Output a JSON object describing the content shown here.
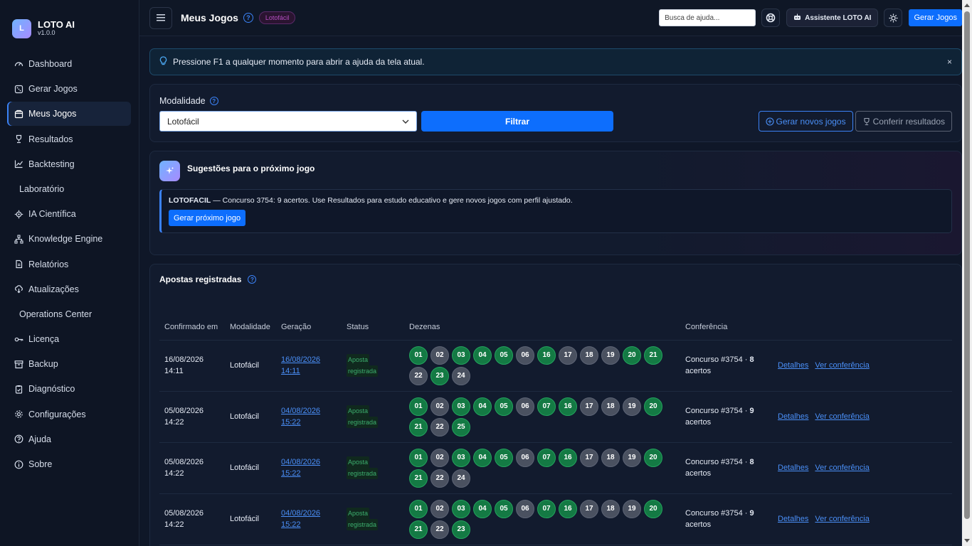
{
  "brand": {
    "name": "LOTO AI",
    "version": "v1.0.0",
    "logo_letter": "L"
  },
  "nav": [
    {
      "label": "Dashboard",
      "icon": "speedometer-icon"
    },
    {
      "label": "Gerar Jogos",
      "icon": "dice-icon"
    },
    {
      "label": "Meus Jogos",
      "icon": "box-icon",
      "active": true
    },
    {
      "label": "Resultados",
      "icon": "trophy-icon"
    },
    {
      "label": "Backtesting",
      "icon": "chart-line-icon"
    },
    {
      "label": "Laboratório",
      "icon": ""
    },
    {
      "label": "IA Científica",
      "icon": "cpu-icon"
    },
    {
      "label": "Knowledge Engine",
      "icon": "diagram-icon"
    },
    {
      "label": "Relatórios",
      "icon": "file-icon"
    },
    {
      "label": "Atualizações",
      "icon": "cloud-download-icon"
    },
    {
      "label": "Operations Center",
      "icon": ""
    },
    {
      "label": "Licença",
      "icon": "key-icon"
    },
    {
      "label": "Backup",
      "icon": "archive-icon"
    },
    {
      "label": "Diagnóstico",
      "icon": "clipboard-icon"
    },
    {
      "label": "Configurações",
      "icon": "gear-icon"
    },
    {
      "label": "Ajuda",
      "icon": "question-icon"
    },
    {
      "label": "Sobre",
      "icon": "info-icon"
    }
  ],
  "topbar": {
    "title": "Meus Jogos",
    "pill": "Lotofácil",
    "search_placeholder": "Busca de ajuda...",
    "assistant_label": "Assistente LOTO AI",
    "generate_label": "Gerar Jogos"
  },
  "alert": {
    "text": "Pressione F1 a qualquer momento para abrir a ajuda da tela atual.",
    "close": "×"
  },
  "filter": {
    "label": "Modalidade",
    "selected": "Lotofácil",
    "filter_button": "Filtrar",
    "new_games": "Gerar novos jogos",
    "check_results": "Conferir resultados"
  },
  "suggestion": {
    "title": "Sugestões para o próximo jogo",
    "game": "LOTOFACIL",
    "text": " — Concurso 3754: 9 acertos. Use Resultados para estudo educativo e gere novos jogos com perfil ajustado.",
    "button": "Gerar próximo jogo"
  },
  "bets": {
    "title": "Apostas registradas",
    "headers": [
      "Confirmado em",
      "Modalidade",
      "Geração",
      "Status",
      "Dezenas",
      "Conferência",
      ""
    ],
    "detail_label": "Detalhes",
    "conf_label": "Ver conferência",
    "rows": [
      {
        "confirmed_date": "16/08/2026",
        "confirmed_time": "14:11",
        "modality": "Lotofácil",
        "gen_date": "16/08/2026",
        "gen_time": "14:11",
        "status_1": "Aposta",
        "status_2": "registrada",
        "numbers": [
          [
            "01",
            1
          ],
          [
            "02",
            0
          ],
          [
            "03",
            1
          ],
          [
            "04",
            1
          ],
          [
            "05",
            1
          ],
          [
            "06",
            0
          ],
          [
            "16",
            1
          ],
          [
            "17",
            0
          ],
          [
            "18",
            0
          ],
          [
            "19",
            0
          ],
          [
            "20",
            1
          ],
          [
            "21",
            1
          ],
          [
            "22",
            0
          ],
          [
            "23",
            1
          ],
          [
            "24",
            0
          ]
        ],
        "conf_1": "Concurso #3754 · ",
        "conf_hits": "8",
        "conf_2": "acertos"
      },
      {
        "confirmed_date": "05/08/2026",
        "confirmed_time": "14:22",
        "modality": "Lotofácil",
        "gen_date": "04/08/2026",
        "gen_time": "15:22",
        "status_1": "Aposta",
        "status_2": "registrada",
        "numbers": [
          [
            "01",
            1
          ],
          [
            "02",
            0
          ],
          [
            "03",
            1
          ],
          [
            "04",
            1
          ],
          [
            "05",
            1
          ],
          [
            "06",
            0
          ],
          [
            "07",
            1
          ],
          [
            "16",
            1
          ],
          [
            "17",
            0
          ],
          [
            "18",
            0
          ],
          [
            "19",
            0
          ],
          [
            "20",
            1
          ],
          [
            "21",
            1
          ],
          [
            "22",
            0
          ],
          [
            "25",
            1
          ]
        ],
        "conf_1": "Concurso #3754 · ",
        "conf_hits": "9",
        "conf_2": "acertos"
      },
      {
        "confirmed_date": "05/08/2026",
        "confirmed_time": "14:22",
        "modality": "Lotofácil",
        "gen_date": "04/08/2026",
        "gen_time": "15:22",
        "status_1": "Aposta",
        "status_2": "registrada",
        "numbers": [
          [
            "01",
            1
          ],
          [
            "02",
            0
          ],
          [
            "03",
            1
          ],
          [
            "04",
            1
          ],
          [
            "05",
            1
          ],
          [
            "06",
            0
          ],
          [
            "07",
            1
          ],
          [
            "16",
            1
          ],
          [
            "17",
            0
          ],
          [
            "18",
            0
          ],
          [
            "19",
            0
          ],
          [
            "20",
            1
          ],
          [
            "21",
            1
          ],
          [
            "22",
            0
          ],
          [
            "24",
            0
          ]
        ],
        "conf_1": "Concurso #3754 · ",
        "conf_hits": "8",
        "conf_2": "acertos"
      },
      {
        "confirmed_date": "05/08/2026",
        "confirmed_time": "14:22",
        "modality": "Lotofácil",
        "gen_date": "04/08/2026",
        "gen_time": "15:22",
        "status_1": "Aposta",
        "status_2": "registrada",
        "numbers": [
          [
            "01",
            1
          ],
          [
            "02",
            0
          ],
          [
            "03",
            1
          ],
          [
            "04",
            1
          ],
          [
            "05",
            1
          ],
          [
            "06",
            0
          ],
          [
            "07",
            1
          ],
          [
            "16",
            1
          ],
          [
            "17",
            0
          ],
          [
            "18",
            0
          ],
          [
            "19",
            0
          ],
          [
            "20",
            1
          ],
          [
            "21",
            1
          ],
          [
            "22",
            0
          ],
          [
            "23",
            1
          ]
        ],
        "conf_1": "Concurso #3754 · ",
        "conf_hits": "9",
        "conf_2": "acertos"
      }
    ]
  },
  "colors": {
    "accent": "#0d6efd",
    "hit": "#147a44",
    "miss": "#4a5160"
  }
}
